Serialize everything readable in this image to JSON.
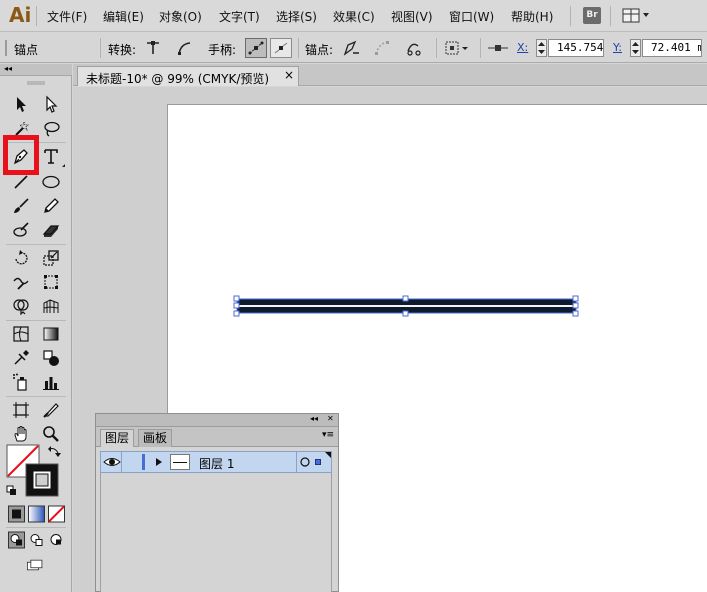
{
  "app": {
    "logo": "Ai",
    "bridge_badge": "Br"
  },
  "menu": [
    {
      "label": "文件(F)"
    },
    {
      "label": "编辑(E)"
    },
    {
      "label": "对象(O)"
    },
    {
      "label": "文字(T)"
    },
    {
      "label": "选择(S)"
    },
    {
      "label": "效果(C)"
    },
    {
      "label": "视图(V)"
    },
    {
      "label": "窗口(W)"
    },
    {
      "label": "帮助(H)"
    }
  ],
  "control_bar": {
    "anchor_label": "锚点",
    "convert_label": "转换:",
    "handles_label": "手柄:",
    "anchors_label": "锚点:",
    "x_label": "X:",
    "x_value": "145.754 ",
    "y_label": "Y:",
    "y_value": "72.401 m"
  },
  "document": {
    "tab_title": "未标题-10* @ 99% (CMYK/预览)",
    "close_glyph": "×"
  },
  "layers_panel": {
    "tabs": [
      {
        "label": "图层"
      },
      {
        "label": "画板"
      }
    ],
    "collapse_glyph": "◂◂",
    "close_glyph": "✕",
    "menu_glyph": "▾≡",
    "layer_name": "图层 1",
    "layer_color": "#4a6bd8"
  },
  "tools": {
    "active_tool": "pen-icon",
    "highlight_color": "#e8101a",
    "collapse_glyph": "◂◂"
  },
  "artwork": {
    "line_color": "#0e1a2e",
    "selection_color": "#4a6bd8"
  }
}
